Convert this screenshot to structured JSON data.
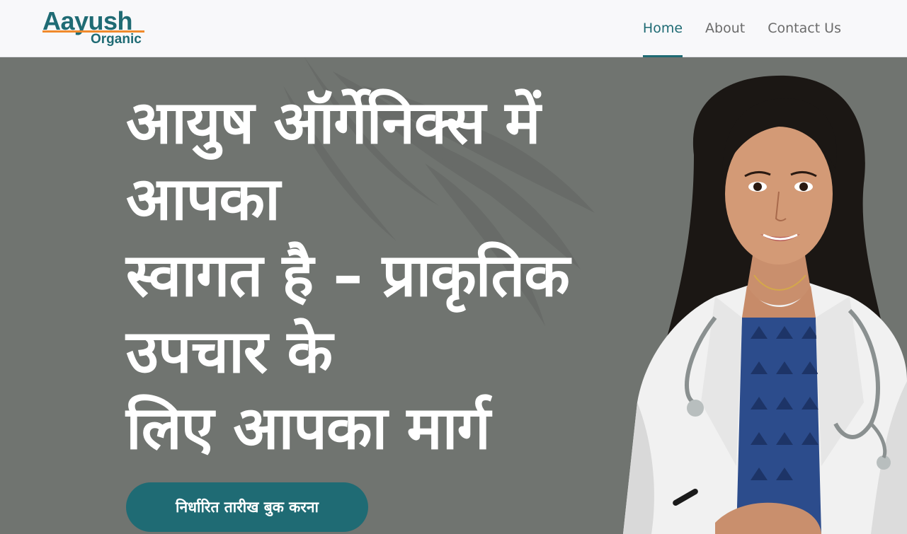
{
  "logo": {
    "main": "Aayush",
    "sub": "Organic"
  },
  "nav": {
    "items": [
      {
        "label": "Home",
        "active": true
      },
      {
        "label": "About",
        "active": false
      },
      {
        "label": "Contact Us",
        "active": false
      }
    ]
  },
  "hero": {
    "title_lines": [
      "आयुष ऑर्गेनिक्स में",
      "आपका",
      "स्वागत है – प्राकृतिक",
      "उपचार के",
      "लिए आपका मार्ग"
    ],
    "cta_label": "निर्धारित तारीख बुक करना"
  },
  "colors": {
    "brand_teal": "#1f6b74",
    "accent_orange": "#f08a2c",
    "hero_background": "#707470",
    "header_background": "#f8f8fa"
  },
  "icons": {
    "hero_image": "doctor-portrait-icon",
    "background_decor": "palm-shadow-icon"
  }
}
